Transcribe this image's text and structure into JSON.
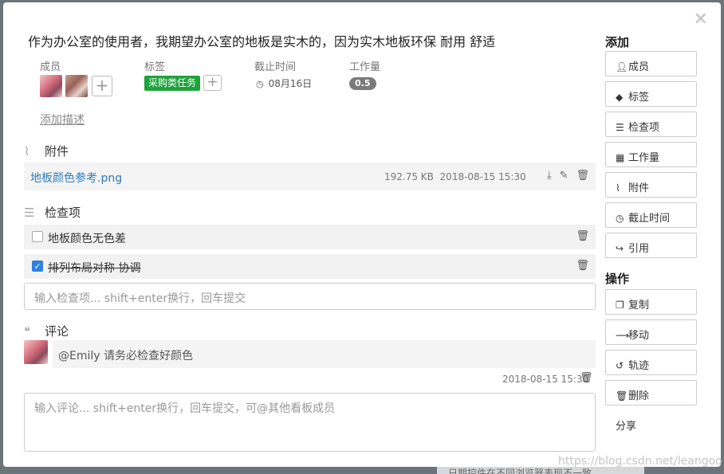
{
  "background_strip_text": "日期控件在不同浏览器表现不一致",
  "card": {
    "title": "作为办公室的使用者，我期望办公室的地板是实木的，因为实木地板环保 耐用 舒适",
    "close_icon": "×",
    "meta": {
      "members_label": "成员",
      "tags_label": "标签",
      "due_label": "截止时间",
      "workload_label": "工作量",
      "tag": "采购类任务",
      "due_date": "08月16日",
      "workload": "0.5"
    },
    "add_description": "添加描述",
    "attachments": {
      "heading": "附件",
      "file": {
        "name": "地板颜色参考.png",
        "size": "192.75 KB",
        "time": "2018-08-15 15:30"
      }
    },
    "checklist": {
      "heading": "检查项",
      "items": [
        {
          "text": "地板颜色无色差",
          "done": false
        },
        {
          "text": "排列布局对称 协调",
          "done": true
        }
      ],
      "input_placeholder": "输入检查项... shift+enter换行，回车提交"
    },
    "comments": {
      "heading": "评论",
      "items": [
        {
          "text": "@Emily 请务必检查好颜色",
          "time": "2018-08-15 15:30"
        }
      ],
      "input_placeholder": "输入评论... shift+enter换行，回车提交，可@其他看板成员"
    }
  },
  "sidebar": {
    "add_title": "添加",
    "add_buttons": [
      "成员",
      "标签",
      "检查项",
      "工作量",
      "附件",
      "截止时间",
      "引用"
    ],
    "ops_title": "操作",
    "op_buttons": [
      "复制",
      "移动",
      "轨迹",
      "删除"
    ],
    "share": "分享"
  },
  "watermark": "https://blog.csdn.net/leangoo",
  "colors": {
    "tag_green": "#1ea33a",
    "link_blue": "#2d7bbd",
    "checkbox_blue": "#2f80e0"
  }
}
